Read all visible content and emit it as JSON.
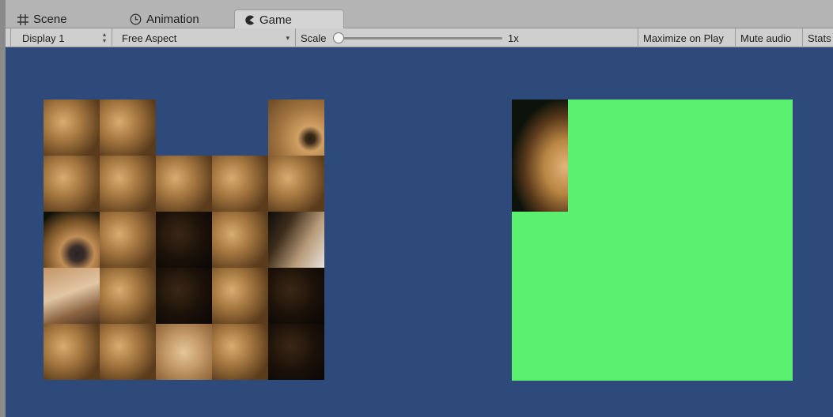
{
  "tabs": [
    {
      "label": "Scene",
      "icon": "grid-icon"
    },
    {
      "label": "Animation",
      "icon": "clock-icon"
    },
    {
      "label": "Game",
      "icon": "pacman-icon",
      "active": true
    }
  ],
  "toolbar": {
    "display": "Display 1",
    "aspect": "Free Aspect",
    "scale_label": "Scale",
    "scale_value": "1x",
    "maximize_label": "Maximize on Play",
    "mute_label": "Mute audio",
    "stats_label": "Stats"
  },
  "colors": {
    "game_background": "#2e4a7a",
    "target_area": "#5cf070",
    "toolbar": "#cfcfcf",
    "tabbar": "#b4b4b4"
  },
  "puzzle": {
    "grid": "5x5",
    "image": "lion photo",
    "tiles": [
      "mane",
      "mane",
      "empty",
      "empty",
      "eye",
      "mane",
      "mane",
      "mane",
      "mane",
      "mane",
      "nose",
      "mane",
      "dark",
      "mane",
      "mouth",
      "muzzle",
      "mane",
      "dark",
      "mane",
      "dark",
      "mane",
      "mane",
      "chin",
      "mane",
      "dark"
    ],
    "placed_tiles": 1
  }
}
